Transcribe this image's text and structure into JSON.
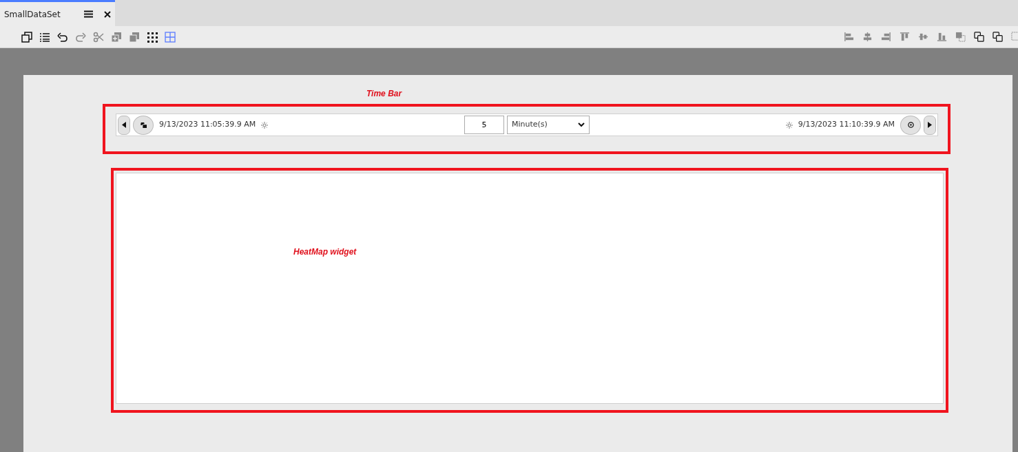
{
  "tab": {
    "title": "SmallDataSet",
    "selected": true
  },
  "toolbar": {
    "left_tools": [
      {
        "kind": "copy",
        "disabled": false,
        "selected": false
      },
      {
        "kind": "list",
        "disabled": false,
        "selected": false
      },
      {
        "kind": "undo",
        "disabled": false,
        "selected": false
      },
      {
        "kind": "redo",
        "disabled": true,
        "selected": false
      },
      {
        "kind": "cut",
        "disabled": true,
        "selected": false
      },
      {
        "kind": "add",
        "disabled": true,
        "selected": false
      },
      {
        "kind": "duplicate",
        "disabled": true,
        "selected": false
      },
      {
        "kind": "dots",
        "disabled": false,
        "selected": false
      },
      {
        "kind": "grid",
        "disabled": false,
        "selected": true
      }
    ],
    "right_tools": [
      {
        "kind": "align-left",
        "disabled": true
      },
      {
        "kind": "align-center",
        "disabled": true
      },
      {
        "kind": "align-right",
        "disabled": true
      },
      {
        "kind": "align-top",
        "disabled": true
      },
      {
        "kind": "align-middle",
        "disabled": true
      },
      {
        "kind": "align-bottom",
        "disabled": true
      },
      {
        "kind": "send-back",
        "disabled": true
      },
      {
        "kind": "bring-front",
        "disabled": false
      },
      {
        "kind": "bring-front",
        "disabled": false
      },
      {
        "kind": "frame",
        "disabled": true
      }
    ]
  },
  "annotations": [
    {
      "text": "Time Bar"
    },
    {
      "text": "HeatMap widget"
    }
  ],
  "time_bar": {
    "start": "9/13/2023 11:05:39.9 AM",
    "interval": "5",
    "unit": "Minute(s)",
    "end": "9/13/2023 11:10:39.9 AM"
  }
}
